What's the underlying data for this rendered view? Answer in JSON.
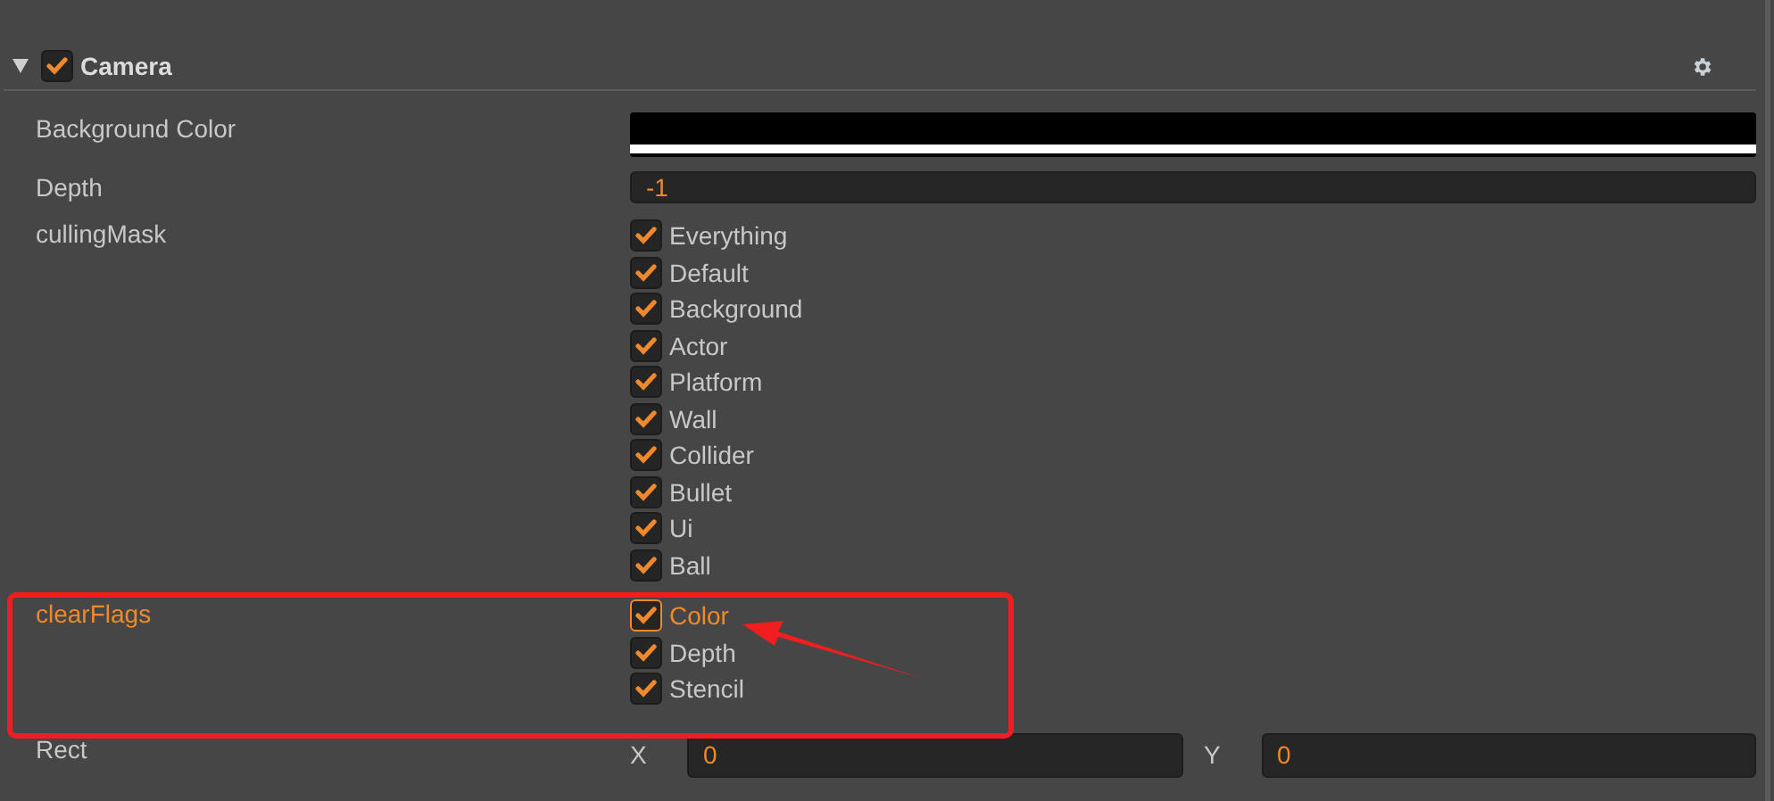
{
  "component": {
    "title": "Camera",
    "expanded": true,
    "enabled": true
  },
  "properties": [
    {
      "kind": "color",
      "label": "Background Color",
      "highlighted": false
    },
    {
      "kind": "text",
      "label": "Depth",
      "highlighted": false,
      "value": "-1"
    },
    {
      "kind": "flags",
      "label": "cullingMask",
      "highlighted": false,
      "options": [
        {
          "label": "Everything",
          "checked": true,
          "selected": false
        },
        {
          "label": "Default",
          "checked": true,
          "selected": false
        },
        {
          "label": "Background",
          "checked": true,
          "selected": false
        },
        {
          "label": "Actor",
          "checked": true,
          "selected": false
        },
        {
          "label": "Platform",
          "checked": true,
          "selected": false
        },
        {
          "label": "Wall",
          "checked": true,
          "selected": false
        },
        {
          "label": "Collider",
          "checked": true,
          "selected": false
        },
        {
          "label": "Bullet",
          "checked": true,
          "selected": false
        },
        {
          "label": "Ui",
          "checked": true,
          "selected": false
        },
        {
          "label": "Ball",
          "checked": true,
          "selected": false
        }
      ]
    },
    {
      "kind": "flags",
      "label": "clearFlags",
      "highlighted": true,
      "annotated": true,
      "options": [
        {
          "label": "Color",
          "checked": true,
          "selected": true
        },
        {
          "label": "Depth",
          "checked": true,
          "selected": false
        },
        {
          "label": "Stencil",
          "checked": true,
          "selected": false
        }
      ]
    },
    {
      "kind": "vector",
      "label": "Rect",
      "highlighted": false,
      "fields": [
        {
          "axis": "X",
          "value": "0"
        },
        {
          "axis": "Y",
          "value": "0"
        }
      ]
    }
  ]
}
